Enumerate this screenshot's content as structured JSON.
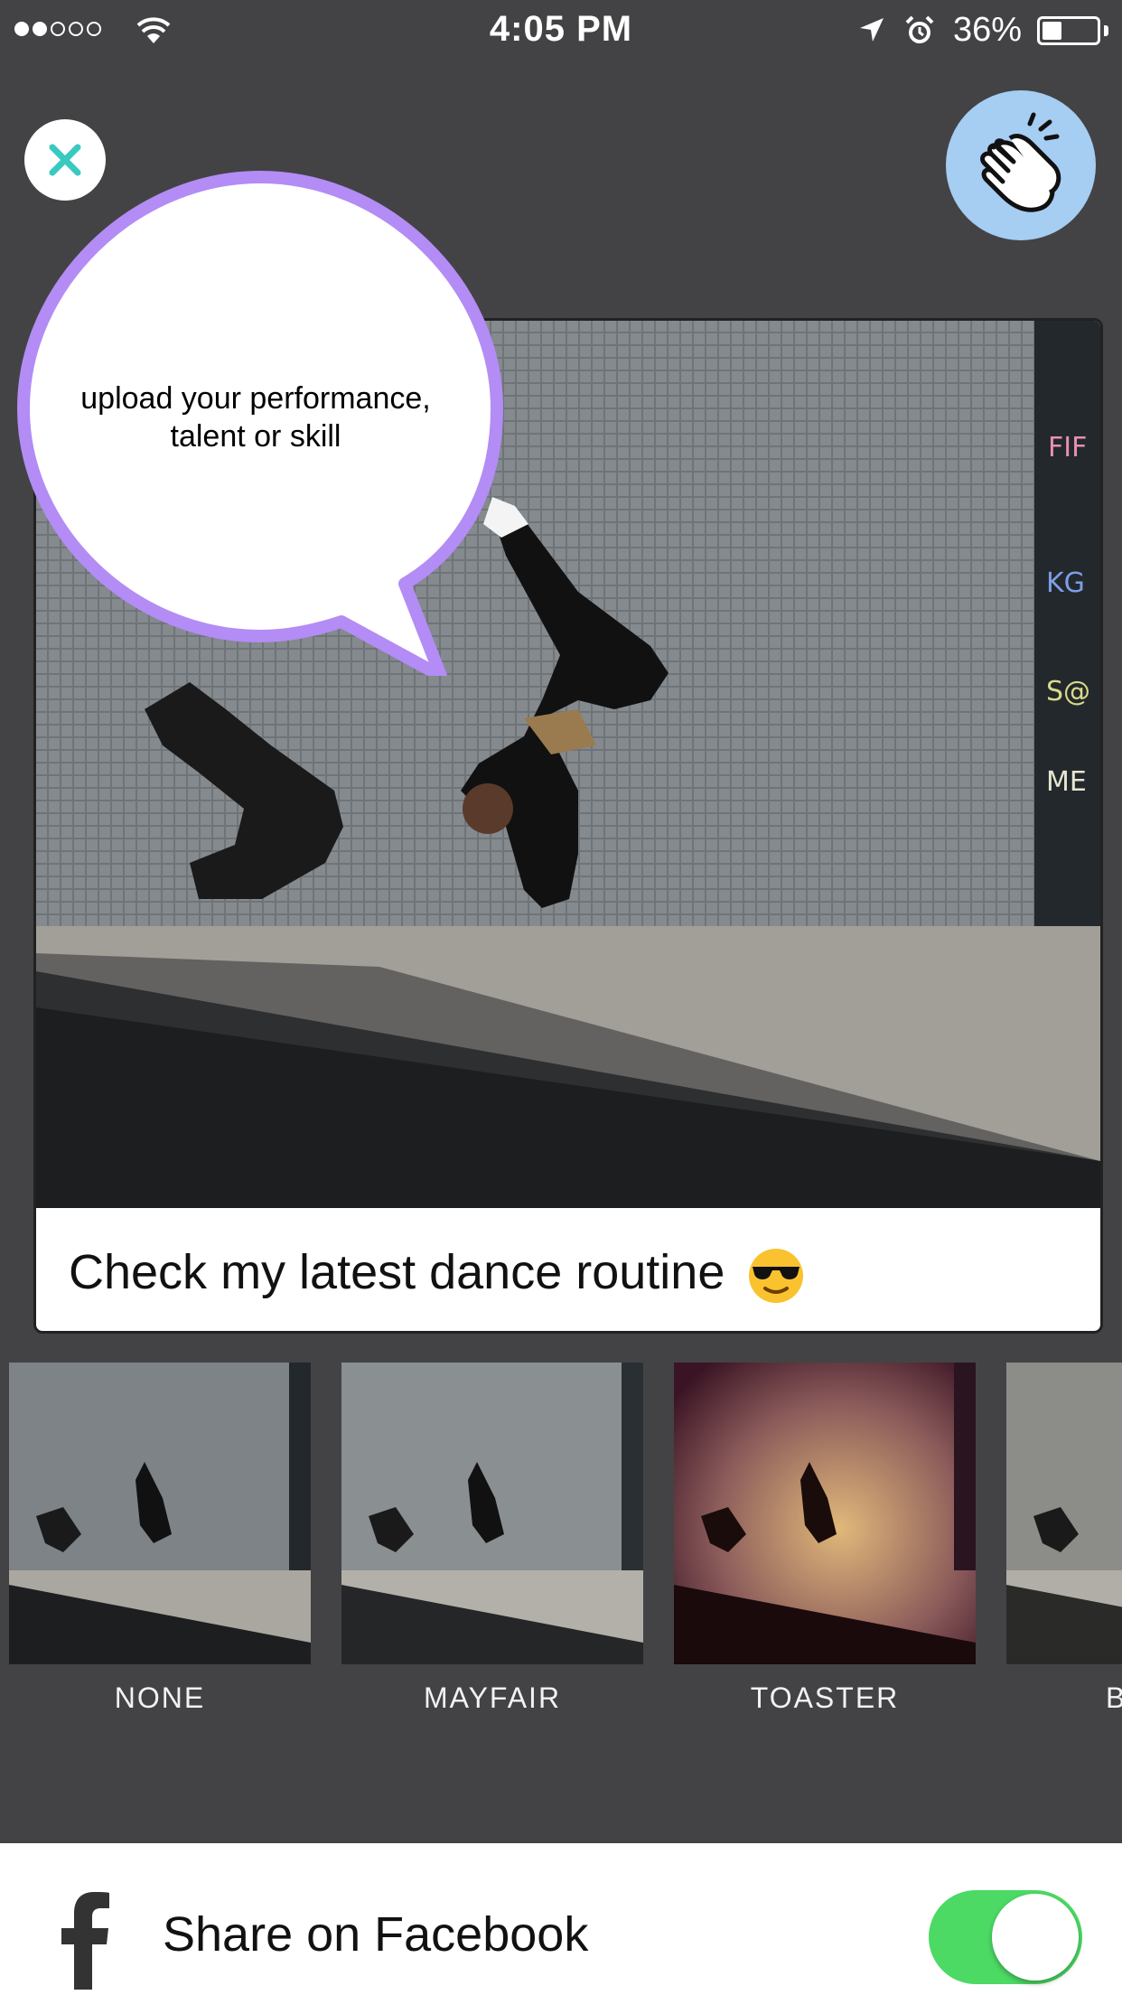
{
  "status_bar": {
    "time": "4:05 PM",
    "battery_percent": "36%",
    "battery_level": 0.36,
    "signal_bars_filled": 2,
    "signal_bars_total": 5
  },
  "speech_bubble": {
    "text": "upload your performance, talent or skill",
    "border_color": "#b38cf5"
  },
  "post": {
    "caption": "Check my latest dance routine"
  },
  "filters": [
    {
      "label": "NONE"
    },
    {
      "label": "MAYFAIR"
    },
    {
      "label": "TOASTER"
    },
    {
      "label": "B"
    }
  ],
  "share": {
    "label": "Share on Facebook",
    "enabled": true,
    "toggle_color": "#4cd964"
  },
  "colors": {
    "background": "#434345",
    "close_icon": "#3ac9c1",
    "clap_button": "#a6cdf2"
  }
}
